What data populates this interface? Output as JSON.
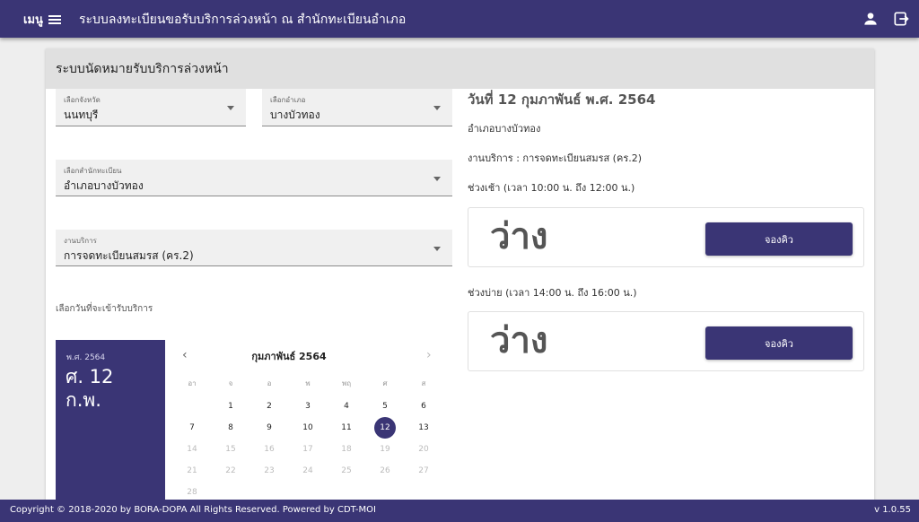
{
  "topbar": {
    "menu_label": "เมนู",
    "title": "ระบบลงทะเบียนขอรับบริการล่วงหน้า ณ สำนักทะเบียนอำเภอ",
    "icons": [
      "account-icon",
      "logout-icon"
    ]
  },
  "card": {
    "title": "ระบบนัดหมายรับบริการล่วงหน้า"
  },
  "form": {
    "province": {
      "label": "เลือกจังหวัด",
      "value": "นนทบุรี"
    },
    "district": {
      "label": "เลือกอำเภอ",
      "value": "บางบัวทอง"
    },
    "office": {
      "label": "เลือกสำนักทะเบียน",
      "value": "อำเภอบางบัวทอง"
    },
    "service": {
      "label": "งานบริการ",
      "value": "การจดทะเบียนสมรส (คร.2)"
    },
    "date_label": "เลือกวันที่จะเข้ารับบริการ"
  },
  "calendar": {
    "year": "พ.ศ. 2564",
    "selected_line1": "ศ. 12",
    "selected_line2": "ก.พ.",
    "month_title": "กุมภาพันธ์ 2564",
    "prev": "‹",
    "next": "›",
    "weekdays": [
      "อา",
      "จ",
      "อ",
      "พ",
      "พฤ",
      "ศ",
      "ส"
    ],
    "days": [
      {
        "d": "1",
        "dim": false
      },
      {
        "d": "2",
        "dim": false
      },
      {
        "d": "3",
        "dim": false
      },
      {
        "d": "4",
        "dim": false
      },
      {
        "d": "5",
        "dim": false
      },
      {
        "d": "6",
        "dim": false
      },
      {
        "d": "7",
        "dim": false
      },
      {
        "d": "8",
        "dim": false
      },
      {
        "d": "9",
        "dim": false
      },
      {
        "d": "10",
        "dim": false
      },
      {
        "d": "11",
        "dim": false
      },
      {
        "d": "12",
        "dim": false,
        "selected": true
      },
      {
        "d": "13",
        "dim": false
      },
      {
        "d": "14",
        "dim": true
      },
      {
        "d": "15",
        "dim": true
      },
      {
        "d": "16",
        "dim": true
      },
      {
        "d": "17",
        "dim": true
      },
      {
        "d": "18",
        "dim": true
      },
      {
        "d": "19",
        "dim": true
      },
      {
        "d": "20",
        "dim": true
      },
      {
        "d": "21",
        "dim": true
      },
      {
        "d": "22",
        "dim": true
      },
      {
        "d": "23",
        "dim": true
      },
      {
        "d": "24",
        "dim": true
      },
      {
        "d": "25",
        "dim": true
      },
      {
        "d": "26",
        "dim": true
      },
      {
        "d": "27",
        "dim": true
      },
      {
        "d": "28",
        "dim": true
      }
    ]
  },
  "detail": {
    "date_title": "วันที่ 12 กุมภาพันธ์ พ.ศ. 2564",
    "office": "อำเภอบางบัวทอง",
    "service": "งานบริการ : การจดทะเบียนสมรส (คร.2)",
    "morning": {
      "label": "ช่วงเช้า (เวลา 10:00 น. ถึง 12:00 น.)",
      "status": "ว่าง",
      "button": "จองคิว"
    },
    "afternoon": {
      "label": "ช่วงบ่าย (เวลา 14:00 น. ถึง 16:00 น.)",
      "status": "ว่าง",
      "button": "จองคิว"
    }
  },
  "footer": {
    "copyright": "Copyright © 2018-2020 by BORA-DOPA All Rights Reserved. Powered by CDT-MOI",
    "version": "v 1.0.55"
  },
  "colors": {
    "primary": "#3a3575",
    "header_grey": "#e0e0e0",
    "background": "#eeeeee"
  }
}
